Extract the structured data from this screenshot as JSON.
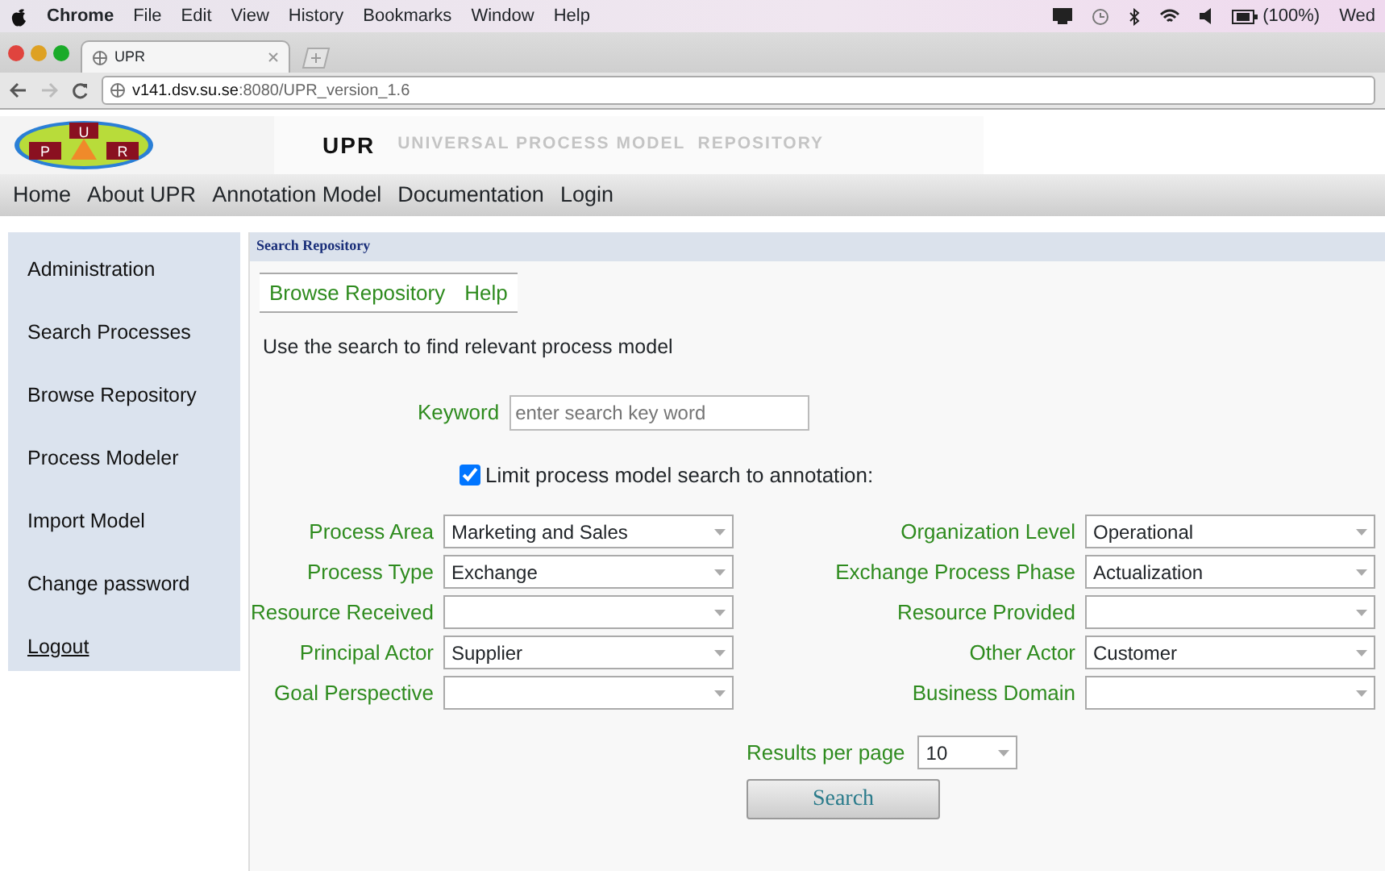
{
  "menubar": {
    "app": "Chrome",
    "menus": [
      "File",
      "Edit",
      "View",
      "History",
      "Bookmarks",
      "Window",
      "Help"
    ],
    "battery": "(100%)",
    "clock": "Wed"
  },
  "browser": {
    "tab_title": "UPR",
    "url_host": "v141.dsv.su.se",
    "url_path": ":8080/UPR_version_1.6"
  },
  "header": {
    "logo_letters": [
      "P",
      "U",
      "R"
    ],
    "title": "UPR",
    "subtitle": "UNIVERSAL PROCESS MODEL  REPOSITORY"
  },
  "nav": [
    "Home",
    "About UPR",
    "Annotation Model",
    "Documentation",
    "Login"
  ],
  "sidebar": {
    "items": [
      "Administration",
      "Search Processes",
      "Browse Repository",
      "Process Modeler",
      "Import Model",
      "Change password"
    ],
    "logout": "Logout"
  },
  "panel": {
    "title": "Search Repository",
    "tabs": [
      "Browse Repository",
      "Help"
    ],
    "intro": "Use the search to find relevant process model",
    "keyword": {
      "label": "Keyword",
      "placeholder": "enter search key word"
    },
    "limit": {
      "label": "Limit process model search to annotation:",
      "checked": true
    },
    "fields": [
      {
        "label": "Process Area",
        "value": "Marketing and Sales"
      },
      {
        "label": "Organization Level",
        "value": "Operational"
      },
      {
        "label": "Process Type",
        "value": "Exchange"
      },
      {
        "label": "Exchange Process Phase",
        "value": "Actualization"
      },
      {
        "label": "Resource Received"
      },
      {
        "label": "Resource Provided"
      },
      {
        "label": "Principal Actor",
        "value": "Supplier"
      },
      {
        "label": "Other Actor",
        "value": "Customer"
      },
      {
        "label": "Goal Perspective"
      },
      {
        "label": "Business Domain"
      }
    ],
    "results_per_page": {
      "label": "Results per page",
      "value": "10"
    },
    "search_button": "Search"
  }
}
